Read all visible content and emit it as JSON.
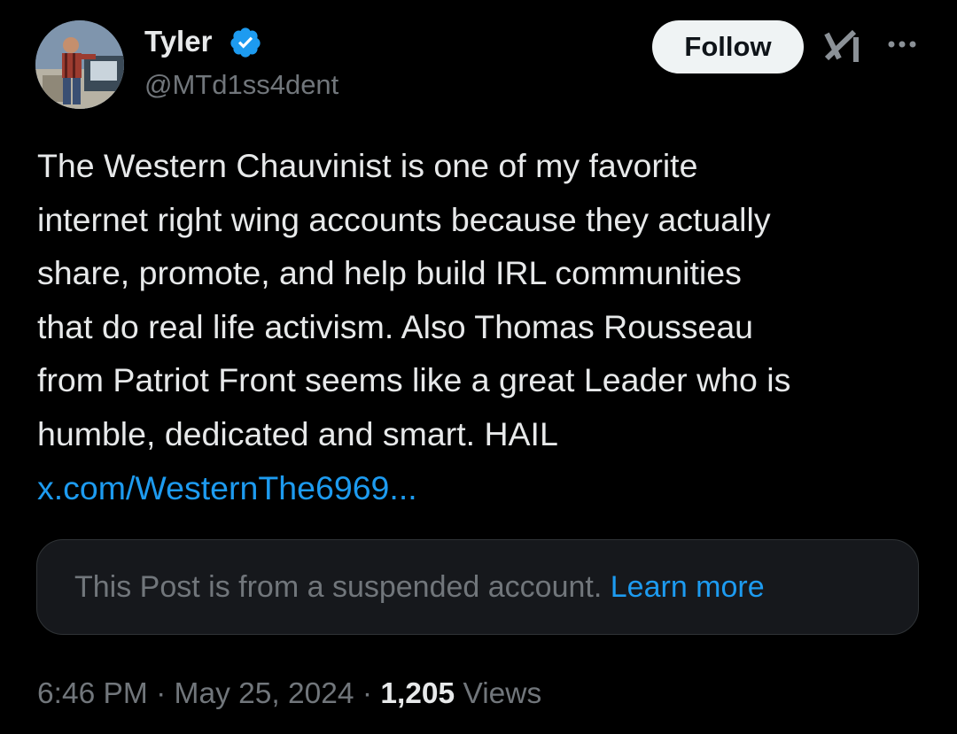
{
  "author": {
    "display_name": "Tyler",
    "handle": "@MTd1ss4dent",
    "verified_icon": "verified-badge-icon",
    "verified_color": "#1d9bf0"
  },
  "header_actions": {
    "follow_label": "Follow",
    "grok_icon": "grok-icon",
    "more_icon": "more-options-icon"
  },
  "post": {
    "text": "The Western Chauvinist is one of my favorite\ninternet right wing accounts because they actually\nshare, promote, and help build IRL communities\nthat do real life activism.  Also Thomas Rousseau\nfrom Patriot Front seems like a great Leader who is\nhumble, dedicated and smart. HAIL",
    "link_text": "x.com/WesternThe6969..."
  },
  "quoted": {
    "notice": "This Post is from a suspended account.",
    "learn_more": "Learn more"
  },
  "meta": {
    "time": "6:46 PM",
    "separator": "·",
    "date": "May 25, 2024",
    "views_count": "1,205",
    "views_label": "Views"
  },
  "colors": {
    "background": "#000000",
    "text_primary": "#e7e9ea",
    "text_secondary": "#71767b",
    "accent": "#1d9bf0",
    "card_bg": "#16181c",
    "card_border": "#2f3336"
  }
}
